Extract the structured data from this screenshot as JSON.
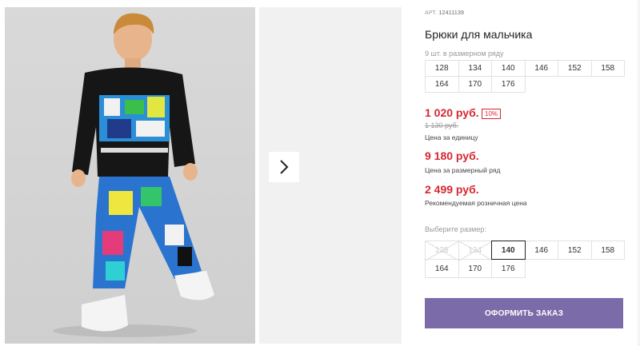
{
  "gallery": {
    "next_icon": "chevron-right-icon"
  },
  "product": {
    "art_label": "АРТ.",
    "art_number": "12411139",
    "title": "Брюки для мальчика",
    "grid_note": "9 шт. в размерном ряду",
    "grid_sizes": [
      "128",
      "134",
      "140",
      "146",
      "152",
      "158",
      "164",
      "170",
      "176"
    ],
    "price": "1 020 руб.",
    "discount": "10%",
    "old_price": "1 130 руб.",
    "price_caption": "Цена за единицу",
    "row_price": "9 180 руб.",
    "row_caption": "Цена за размерный ряд",
    "retail_price": "2 499 руб.",
    "retail_caption": "Рекомендуемая розничная цена"
  },
  "size_picker": {
    "label": "Выберите размер:",
    "sizes": [
      {
        "label": "128",
        "state": "disabled"
      },
      {
        "label": "134",
        "state": "disabled"
      },
      {
        "label": "140",
        "state": "selected"
      },
      {
        "label": "146",
        "state": "available"
      },
      {
        "label": "152",
        "state": "available"
      },
      {
        "label": "158",
        "state": "available"
      },
      {
        "label": "164",
        "state": "available"
      },
      {
        "label": "170",
        "state": "available"
      },
      {
        "label": "176",
        "state": "available"
      }
    ]
  },
  "order_button": "ОФОРМИТЬ ЗАКАЗ",
  "colors": {
    "price_red": "#d62730",
    "button": "#7b6ba8"
  }
}
